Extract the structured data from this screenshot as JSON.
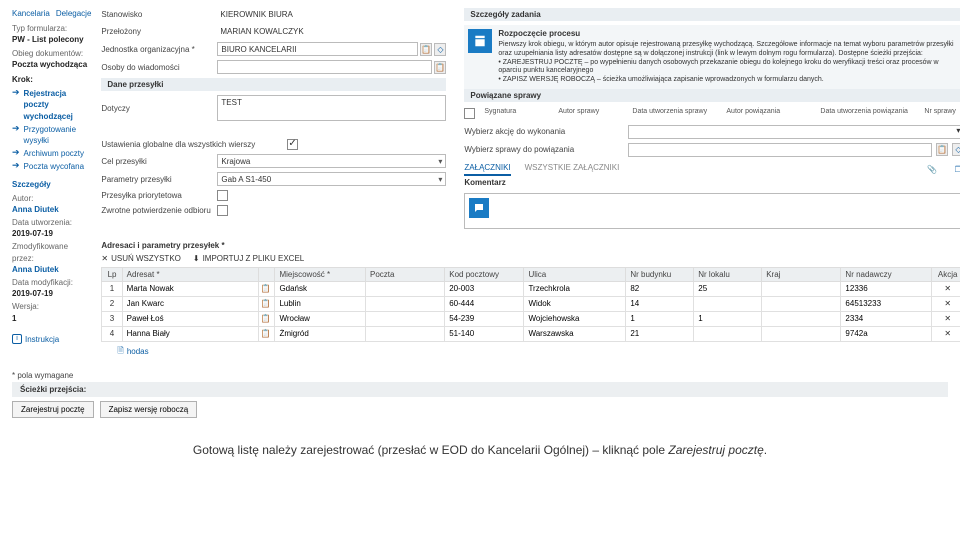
{
  "sidebar": {
    "tabs": [
      "Kancelaria",
      "Delegacje"
    ],
    "lbl_type": "Typ formularza:",
    "type": "PW - List polecony",
    "lbl_flow": "Obieg dokumentów:",
    "flow": "Poczta wychodząca",
    "krok_head": "Krok:",
    "krok": [
      "Rejestracja poczty wychodzącej",
      "Przygotowanie wysyłki",
      "Archiwum poczty",
      "Poczta wycofana"
    ],
    "szcz_head": "Szczegóły",
    "lbl_author": "Autor:",
    "author": "Anna Diutek",
    "lbl_created": "Data utworzenia:",
    "created": "2019-07-19",
    "lbl_mod": "Zmodyfikowane przez:",
    "mod_by": "Anna Diutek",
    "lbl_moddate": "Data modyfikacji:",
    "moddate": "2019-07-19",
    "lbl_ver": "Wersja:",
    "ver": "1",
    "instr": "Instrukcja"
  },
  "formL": {
    "stanowisko_lbl": "Stanowisko",
    "stanowisko": "KIEROWNIK BIURA",
    "przelozony_lbl": "Przełożony",
    "przelozony": "MARIAN KOWALCZYK",
    "jednostka_lbl": "Jednostka organizacyjna *",
    "jednostka": "BIURO KANCELARII",
    "osoby_lbl": "Osoby do wiadomości",
    "osoby": "",
    "dane_prz": "Dane przesyłki",
    "dotyczy_lbl": "Dotyczy",
    "dotyczy": "TEST",
    "ustaw_lbl": "Ustawienia globalne dla wszystkich wierszy",
    "cel_lbl": "Cel przesyłki",
    "cel": "Krajowa",
    "param_lbl": "Parametry przesyłki",
    "param": "Gab A S1-450",
    "priorytet_lbl": "Przesyłka priorytetowa",
    "zwrotne_lbl": "Zwrotne potwierdzenie odbioru"
  },
  "right": {
    "sz_head": "Szczegóły zadania",
    "proc_title": "Rozpoczęcie procesu",
    "proc_p1": "Pierwszy krok obiegu, w którym autor opisuje rejestrowaną przesyłkę wychodzącą. Szczegółowe informacje na temat wyboru parametrów przesyłki oraz uzupełniania listy adresatów dostępne są w dołączonej instrukcji (link w lewym dolnym rogu formularza). Dostępne ścieżki przejścia:",
    "proc_b1": "• ZAREJESTRUJ POCZTĘ – po wypełnieniu danych osobowych przekazanie obiegu do kolejnego kroku do weryfikacji treści oraz procesów w oparciu punktu kancelaryjnego",
    "proc_b2": "• ZAPISZ WERSJĘ ROBOCZĄ – ścieżka umożliwiająca zapisanie wprowadzonych w formularzu danych.",
    "pow_head": "Powiązane sprawy",
    "pow_cols": [
      "",
      "Sygnatura",
      "Autor sprawy",
      "Data utworzenia sprawy",
      "Autor powiązania",
      "Data utworzenia powiązania",
      "Nr sprawy"
    ],
    "wyb_akcje_lbl": "Wybierz akcję do wykonania",
    "wyb_sprawy_lbl": "Wybierz sprawy do powiązania",
    "tabs": [
      "ZAŁĄCZNIKI",
      "WSZYSTKIE ZAŁĄCZNIKI"
    ],
    "kom_head": "Komentarz"
  },
  "addr": {
    "title": "Adresaci i parametry przesyłek *",
    "tool_rm": "USUŃ WSZYSTKO",
    "tool_imp": "IMPORTUJ Z PLIKU EXCEL",
    "cols": [
      "Lp",
      "Adresat *",
      "",
      "Miejscowość *",
      "Poczta",
      "Kod pocztowy",
      "Ulica",
      "Nr budynku",
      "Nr lokalu",
      "Kraj",
      "Nr nadawczy",
      "Akcja"
    ],
    "rows": [
      {
        "lp": "1",
        "adresat": "Marta Nowak",
        "miej": "Gdańsk",
        "poczta": "",
        "kod": "20-003",
        "ulica": "Trzechkrola",
        "bud": "82",
        "lok": "25",
        "kraj": "",
        "nad": "12336"
      },
      {
        "lp": "2",
        "adresat": "Jan Kwarc",
        "miej": "Lublin",
        "poczta": "",
        "kod": "60-444",
        "ulica": "Widok",
        "bud": "14",
        "lok": "",
        "kraj": "",
        "nad": "64513233"
      },
      {
        "lp": "3",
        "adresat": "Paweł Łoś",
        "miej": "Wrocław",
        "poczta": "",
        "kod": "54-239",
        "ulica": "Wojciehowska",
        "bud": "1",
        "lok": "1",
        "kraj": "",
        "nad": "2334"
      },
      {
        "lp": "4",
        "adresat": "Hanna Biały",
        "miej": "Żmigród",
        "poczta": "",
        "kod": "51-140",
        "ulica": "Warszawska",
        "bud": "21",
        "lok": "",
        "kraj": "",
        "nad": "9742a"
      }
    ],
    "hodas": "hodas"
  },
  "foot": {
    "req": "* pola wymagane",
    "path": "Ścieżki przejścia:",
    "btn_rej": "Zarejestruj pocztę",
    "btn_zap": "Zapisz wersję roboczą"
  },
  "caption": {
    "t1": "Gotową listę należy zarejestrować (przesłać w EOD do Kancelarii Ogólnej) – kliknąć pole ",
    "t2": "Zarejestruj pocztę",
    "t3": "."
  }
}
